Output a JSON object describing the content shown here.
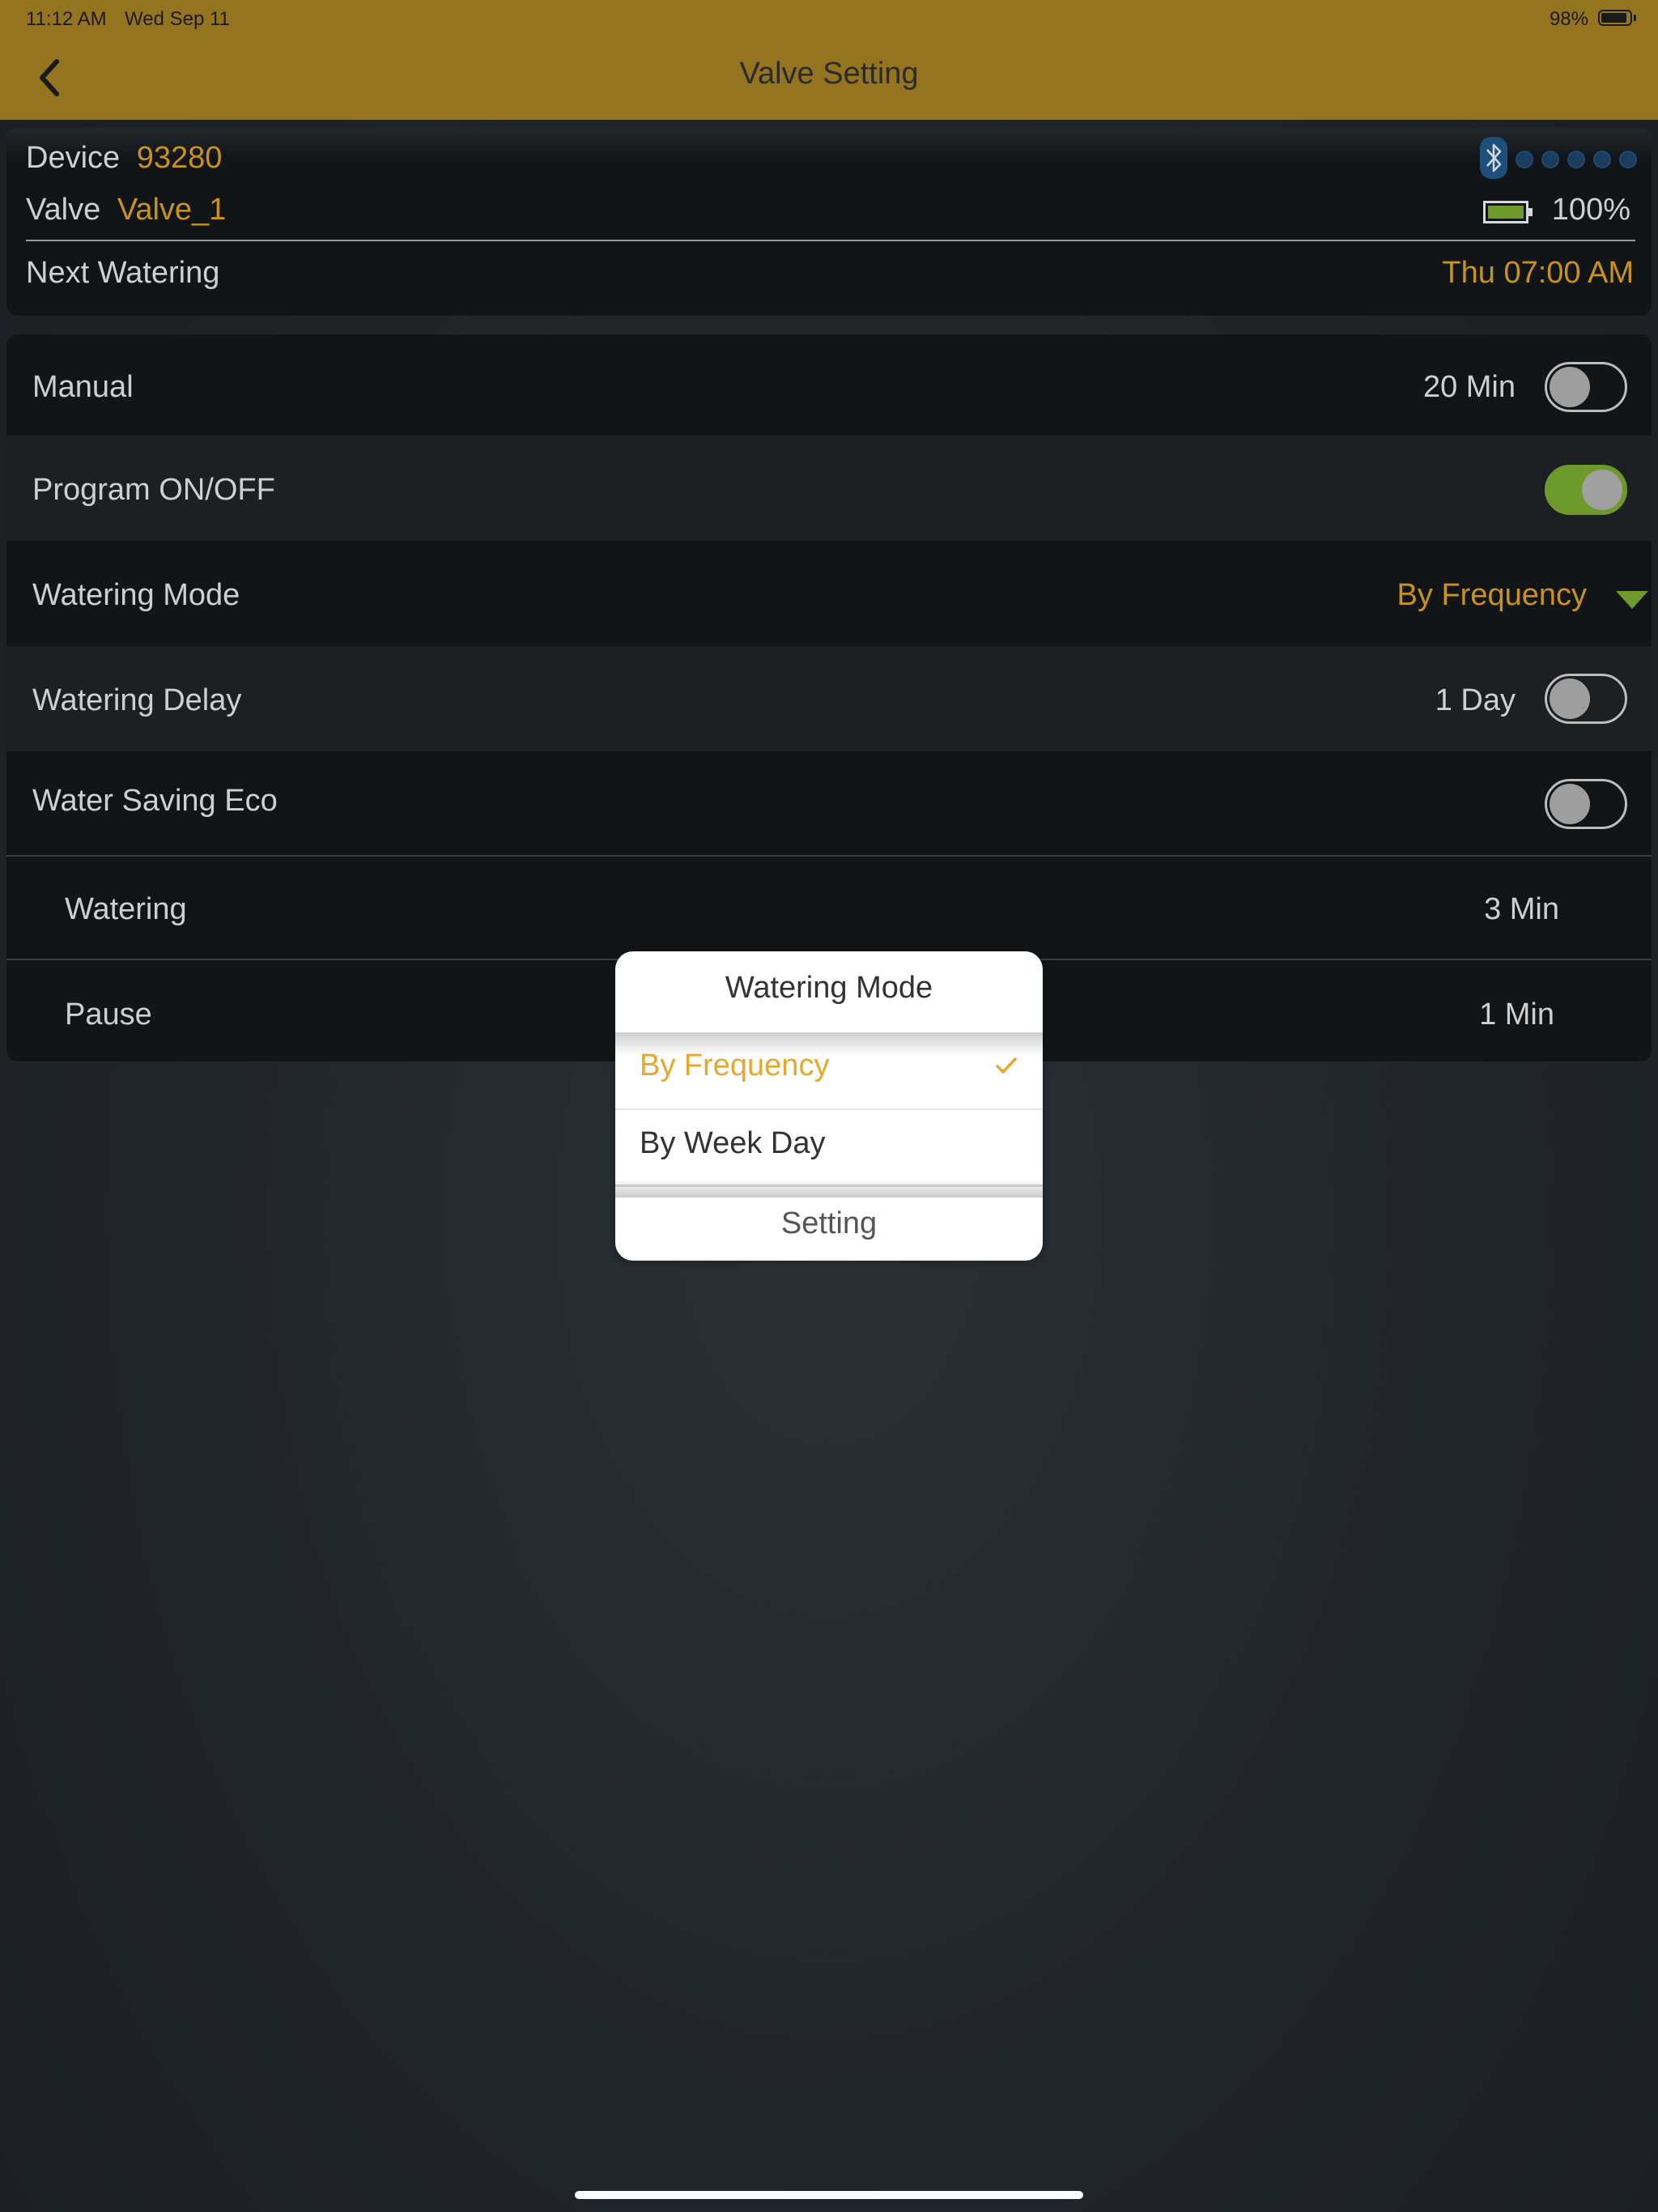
{
  "status_bar": {
    "time": "11:12 AM",
    "date": "Wed Sep 11",
    "battery_text": "98%"
  },
  "nav": {
    "title": "Valve Setting",
    "back_icon": "chevron-left-icon"
  },
  "info": {
    "device_label": "Device",
    "device_value": "93280",
    "valve_label": "Valve",
    "valve_value": "Valve_1",
    "battery_text": "100%",
    "battery_level": 1.0,
    "next_label": "Next Watering",
    "next_value": "Thu 07:00 AM",
    "bluetooth_icon": "bluetooth-icon",
    "signal_dots": 5
  },
  "settings": {
    "manual_label": "Manual",
    "manual_value": "20 Min",
    "manual_on": false,
    "program_label": "Program ON/OFF",
    "program_on": true,
    "mode_label": "Watering Mode",
    "mode_value": "By Frequency",
    "delay_label": "Watering Delay",
    "delay_value": "1 Day",
    "delay_on": false,
    "eco_label": "Water Saving Eco",
    "eco_on": false,
    "watering_label": "Watering",
    "watering_value": "3 Min",
    "pause_label": "Pause",
    "pause_value": "1 Min"
  },
  "popup": {
    "title": "Watering Mode",
    "options": [
      {
        "label": "By Frequency",
        "selected": true
      },
      {
        "label": "By Week Day",
        "selected": false
      }
    ],
    "check_icon": "checkmark-icon",
    "setting_label": "Setting"
  },
  "colors": {
    "header": "#94741e",
    "accent_gold": "#c9921d",
    "toggle_on": "#6d9a2a",
    "popup_selected": "#e8a82e",
    "bluetooth": "#1e4f7a"
  }
}
